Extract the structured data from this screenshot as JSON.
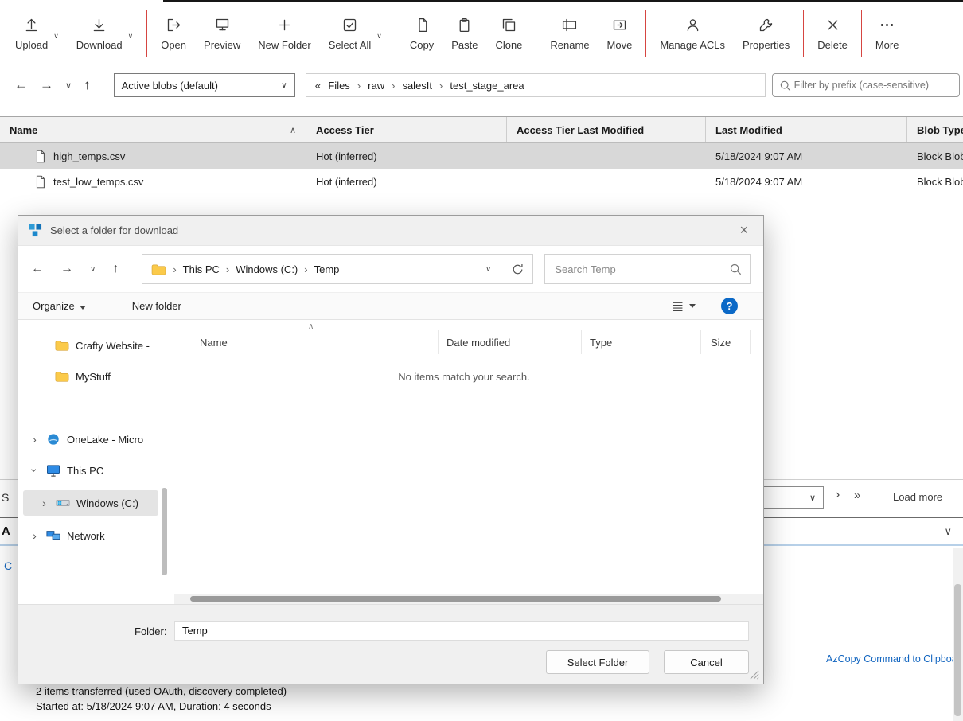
{
  "icons": {
    "chevron_down": "∨",
    "chevron_up": "∧",
    "chevron_right": "›",
    "collapse_left": "«",
    "double_right": "»",
    "arrow_left": "←",
    "arrow_right": "→",
    "arrow_up": "↑",
    "close": "×",
    "help": "?"
  },
  "colors": {
    "toolbar_separator_red": "#d64541",
    "link_blue": "#1366c0",
    "help_blue": "#0b69c7",
    "selected_row_gray": "#d8d8d8",
    "activities_accent": "#b7d0e8"
  },
  "toolbar": {
    "items": [
      {
        "label": "Upload"
      },
      {
        "label": "Download"
      },
      {
        "label": "Open"
      },
      {
        "label": "Preview"
      },
      {
        "label": "New Folder"
      },
      {
        "label": "Select All"
      },
      {
        "label": "Copy"
      },
      {
        "label": "Paste"
      },
      {
        "label": "Clone"
      },
      {
        "label": "Rename"
      },
      {
        "label": "Move"
      },
      {
        "label": "Manage ACLs"
      },
      {
        "label": "Properties"
      },
      {
        "label": "Delete"
      },
      {
        "label": "More"
      }
    ]
  },
  "navbar": {
    "blob_state_dropdown": "Active blobs (default)",
    "breadcrumb": [
      "Files",
      "raw",
      "salesIt",
      "test_stage_area"
    ],
    "filter_placeholder": "Filter by prefix (case-sensitive)"
  },
  "blob_table": {
    "headers": {
      "name": "Name",
      "access_tier": "Access Tier",
      "access_tier_last_modified": "Access Tier Last Modified",
      "last_modified": "Last Modified",
      "blob_type": "Blob Type"
    },
    "rows": [
      {
        "name": "high_temps.csv",
        "access_tier": "Hot (inferred)",
        "access_tier_last_modified": "",
        "last_modified": "5/18/2024 9:07 AM",
        "blob_type": "Block Blob"
      },
      {
        "name": "test_low_temps.csv",
        "access_tier": "Hot (inferred)",
        "access_tier_last_modified": "",
        "last_modified": "5/18/2024 9:07 AM",
        "blob_type": "Block Blob"
      }
    ]
  },
  "dialog": {
    "title": "Select a folder for download",
    "address": [
      "This PC",
      "Windows (C:)",
      "Temp"
    ],
    "search_placeholder": "Search Temp",
    "organize": "Organize",
    "new_folder": "New folder",
    "headers": [
      "Name",
      "Date modified",
      "Type",
      "Size"
    ],
    "empty_message": "No items match your search.",
    "sidebar": [
      {
        "label": "Crafty Website -"
      },
      {
        "label": "MyStuff"
      },
      {
        "label": "OneLake - Micro"
      },
      {
        "label": "This PC"
      },
      {
        "label": "Windows (C:)"
      },
      {
        "label": "Network"
      }
    ],
    "folder_label": "Folder:",
    "folder_value": "Temp",
    "buttons": {
      "select": "Select Folder",
      "cancel": "Cancel"
    }
  },
  "background": {
    "load_more": "Load more",
    "azcopy_link": "AzCopy Command to Clipboard",
    "status_line1": "2 items transferred (used OAuth, discovery completed)",
    "status_line2": "Started at: 5/18/2024 9:07 AM, Duration: 4 seconds",
    "summary_fragment": "S",
    "activities_fragment": "A",
    "clear_fragment": "C"
  }
}
